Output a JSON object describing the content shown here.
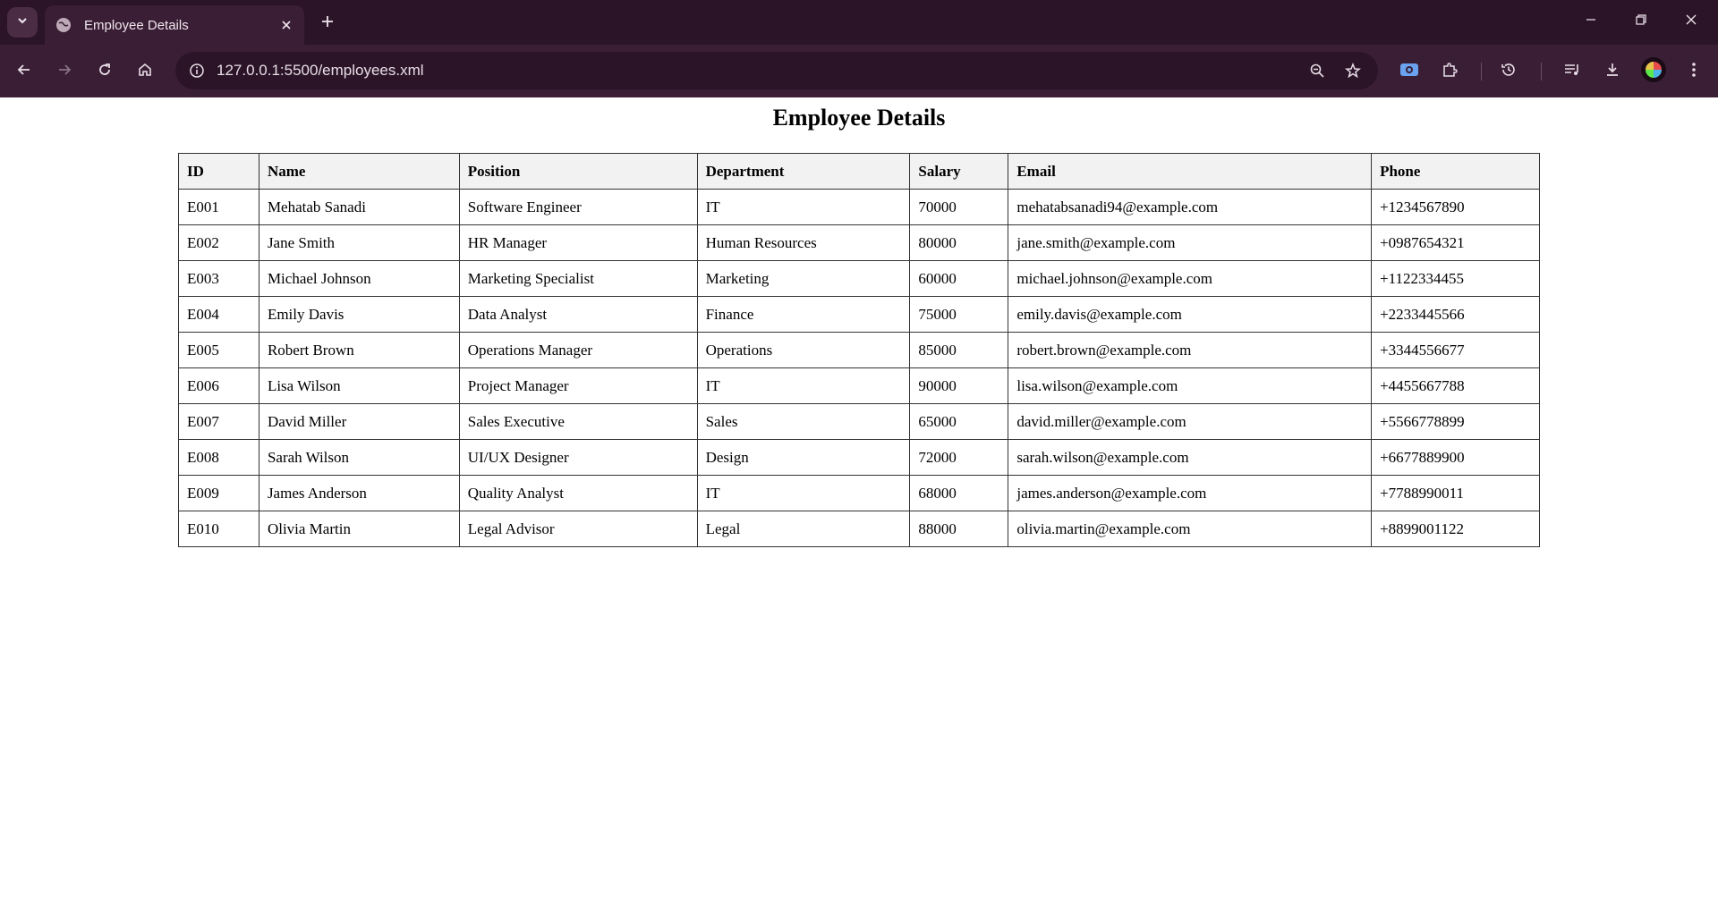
{
  "browser": {
    "tab_title": "Employee Details",
    "url": "127.0.0.1:5500/employees.xml",
    "icons": {
      "tab_search": "chevron-down-icon",
      "favicon": "globe-icon",
      "tab_close": "close-icon",
      "new_tab": "plus-icon",
      "back": "arrow-left-icon",
      "forward": "arrow-right-icon",
      "reload": "reload-icon",
      "home": "home-icon",
      "site_info": "info-icon",
      "zoom": "zoom-out-icon",
      "bookmark": "star-icon",
      "extensions": "puzzle-icon",
      "history": "history-icon",
      "media": "media-queue-icon",
      "downloads": "download-icon",
      "menu": "kebab-menu-icon"
    },
    "colors": {
      "tabstrip": "#2b1428",
      "toolbar": "#3a1e35",
      "omnibox": "#2b1428"
    }
  },
  "page": {
    "title": "Employee Details",
    "table": {
      "headers": [
        "ID",
        "Name",
        "Position",
        "Department",
        "Salary",
        "Email",
        "Phone"
      ],
      "rows": [
        [
          "E001",
          "Mehatab Sanadi",
          "Software Engineer",
          "IT",
          "70000",
          "mehatabsanadi94@example.com",
          "+1234567890"
        ],
        [
          "E002",
          "Jane Smith",
          "HR Manager",
          "Human Resources",
          "80000",
          "jane.smith@example.com",
          "+0987654321"
        ],
        [
          "E003",
          "Michael Johnson",
          "Marketing Specialist",
          "Marketing",
          "60000",
          "michael.johnson@example.com",
          "+1122334455"
        ],
        [
          "E004",
          "Emily Davis",
          "Data Analyst",
          "Finance",
          "75000",
          "emily.davis@example.com",
          "+2233445566"
        ],
        [
          "E005",
          "Robert Brown",
          "Operations Manager",
          "Operations",
          "85000",
          "robert.brown@example.com",
          "+3344556677"
        ],
        [
          "E006",
          "Lisa Wilson",
          "Project Manager",
          "IT",
          "90000",
          "lisa.wilson@example.com",
          "+4455667788"
        ],
        [
          "E007",
          "David Miller",
          "Sales Executive",
          "Sales",
          "65000",
          "david.miller@example.com",
          "+5566778899"
        ],
        [
          "E008",
          "Sarah Wilson",
          "UI/UX Designer",
          "Design",
          "72000",
          "sarah.wilson@example.com",
          "+6677889900"
        ],
        [
          "E009",
          "James Anderson",
          "Quality Analyst",
          "IT",
          "68000",
          "james.anderson@example.com",
          "+7788990011"
        ],
        [
          "E010",
          "Olivia Martin",
          "Legal Advisor",
          "Legal",
          "88000",
          "olivia.martin@example.com",
          "+8899001122"
        ]
      ]
    }
  }
}
